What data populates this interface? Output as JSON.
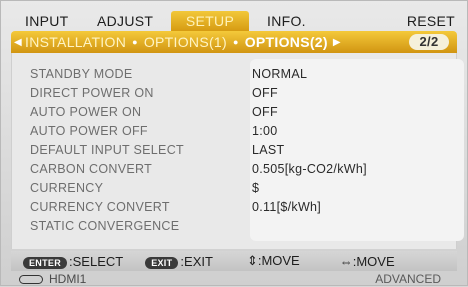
{
  "tabs": [
    "INPUT",
    "ADJUST",
    "SETUP",
    "INFO.",
    "RESET"
  ],
  "active_tab": "SETUP",
  "subtabs": {
    "installation": "INSTALLATION",
    "options1": "OPTIONS(1)",
    "options2": "OPTIONS(2)",
    "page": "2/2"
  },
  "rows": [
    {
      "label": "STANDBY MODE",
      "value": "NORMAL"
    },
    {
      "label": "DIRECT POWER ON",
      "value": "OFF"
    },
    {
      "label": "AUTO POWER ON",
      "value": "OFF"
    },
    {
      "label": "AUTO POWER OFF",
      "value": "1:00"
    },
    {
      "label": "DEFAULT INPUT SELECT",
      "value": "LAST"
    },
    {
      "label": "CARBON CONVERT",
      "value": "0.505[kg-CO2/kWh]"
    },
    {
      "label": "CURRENCY",
      "value": "$"
    },
    {
      "label": "CURRENCY CONVERT",
      "value": "0.11[$/kWh]"
    },
    {
      "label": "STATIC CONVERGENCE",
      "value": ""
    }
  ],
  "help": {
    "enter_key": "ENTER",
    "select": ":SELECT",
    "exit_key": "EXIT",
    "exit": ":EXIT",
    "move_ud": "⇕:MOVE",
    "move_lr": "⇔:MOVE"
  },
  "status": {
    "source": "HDMI1",
    "mode": "ADVANCED"
  },
  "colors": {
    "accent_orange": "#e0a820",
    "label_gray": "#6e6e6e"
  }
}
